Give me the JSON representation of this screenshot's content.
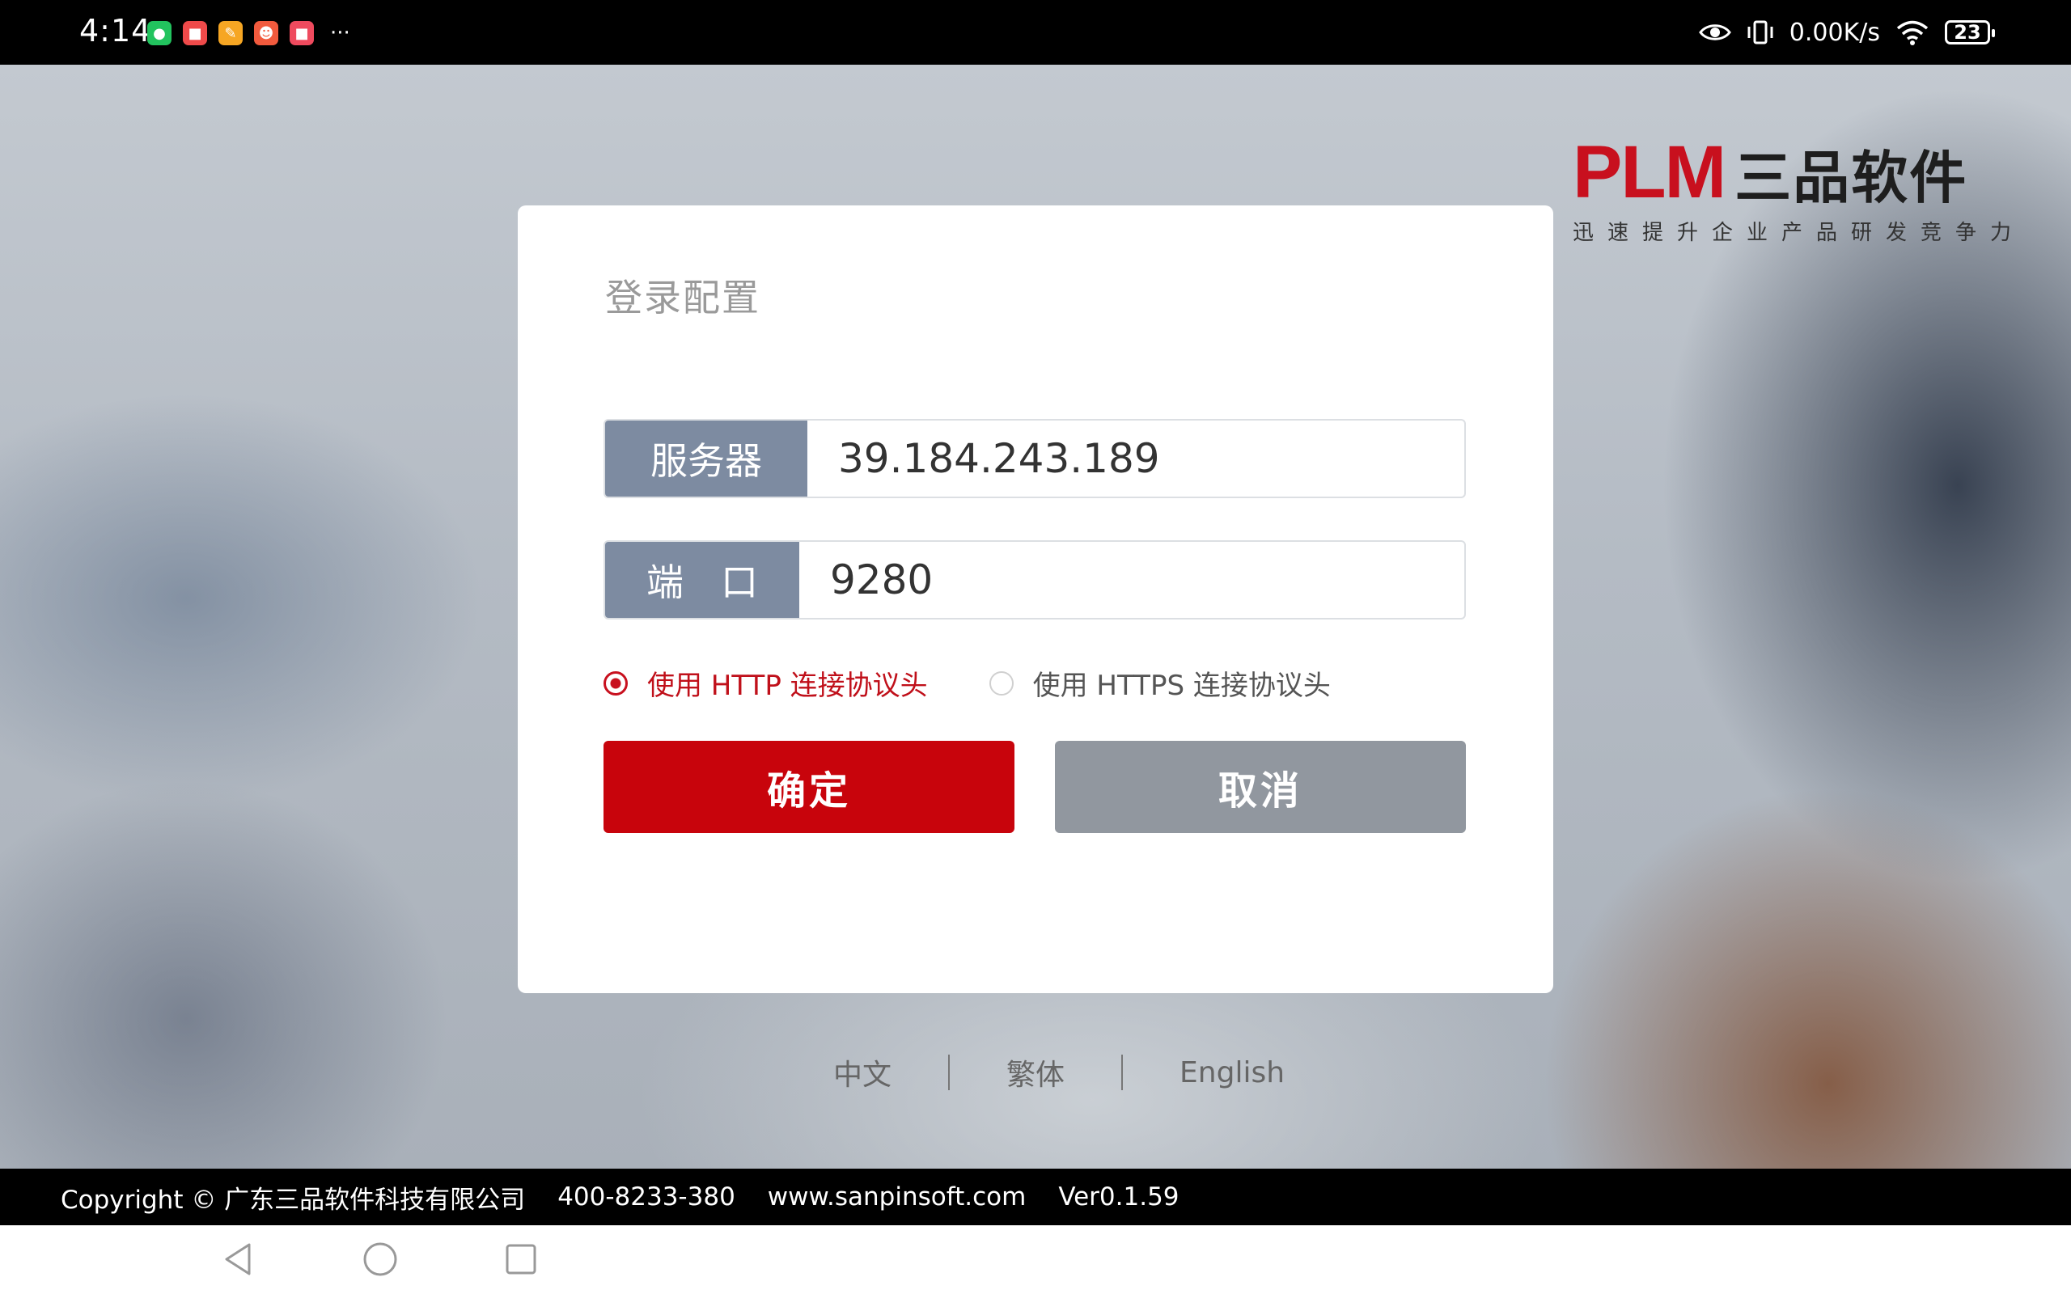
{
  "status_bar": {
    "time": "4:14",
    "apps": [
      {
        "name": "wechat-icon",
        "color": "#22c35e",
        "glyph": "●"
      },
      {
        "name": "app-red-icon",
        "color": "#ef4a4a",
        "glyph": "■"
      },
      {
        "name": "app-orange-icon",
        "color": "#f6a623",
        "glyph": "✎"
      },
      {
        "name": "app-tomato-icon",
        "color": "#f25a3d",
        "glyph": "☻"
      },
      {
        "name": "app-pink-icon",
        "color": "#ef4a5e",
        "glyph": "■"
      }
    ],
    "more": "···",
    "network_speed": "0.00K/s",
    "battery": "23"
  },
  "logo": {
    "plm": "PLM",
    "cn": "三品软件",
    "tagline": "迅速提升企业产品研发竞争力"
  },
  "dialog": {
    "title": "登录配置",
    "server_label": "服务器",
    "server_value": "39.184.243.189",
    "port_label": "端　口",
    "port_value": "9280",
    "radio_http": "使用 HTTP 连接协议头",
    "radio_https": "使用 HTTPS 连接协议头",
    "ok_label": "确定",
    "cancel_label": "取消"
  },
  "languages": {
    "zh": "中文",
    "tw": "繁体",
    "en": "English"
  },
  "footer": {
    "copyright": "Copyright © 广东三品软件科技有限公司",
    "phone": "400-8233-380",
    "website": "www.sanpinsoft.com",
    "version": "Ver0.1.59"
  },
  "colors": {
    "accent": "#c8040c",
    "label_bg": "#7d8ba1",
    "cancel_bg": "#91979f"
  }
}
